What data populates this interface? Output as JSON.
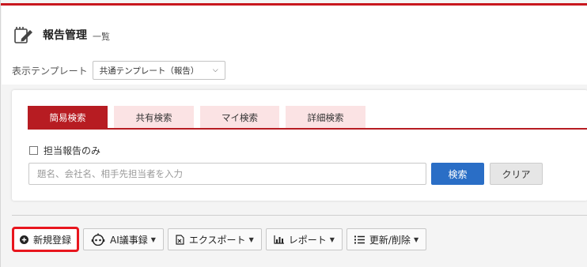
{
  "header": {
    "title": "報告管理",
    "subtitle": "一覧"
  },
  "template": {
    "label": "表示テンプレート",
    "selected": "共通テンプレート（報告）"
  },
  "search": {
    "tabs": [
      {
        "label": "簡易検索",
        "active": true
      },
      {
        "label": "共有検索",
        "active": false
      },
      {
        "label": "マイ検索",
        "active": false
      },
      {
        "label": "詳細検索",
        "active": false
      }
    ],
    "only_mine_label": "担当報告のみ",
    "placeholder": "題名、会社名、相手先担当者を入力",
    "search_label": "検索",
    "clear_label": "クリア"
  },
  "toolbar": {
    "new_label": "新規登録",
    "ai_label": "AI議事録",
    "export_label": "エクスポート",
    "report_label": "レポート",
    "update_label": "更新/削除"
  },
  "colors": {
    "brand_red": "#c8171e",
    "tab_inactive": "#fbe3e4",
    "search_blue": "#2a6ec6",
    "highlight": "#e8161e"
  }
}
